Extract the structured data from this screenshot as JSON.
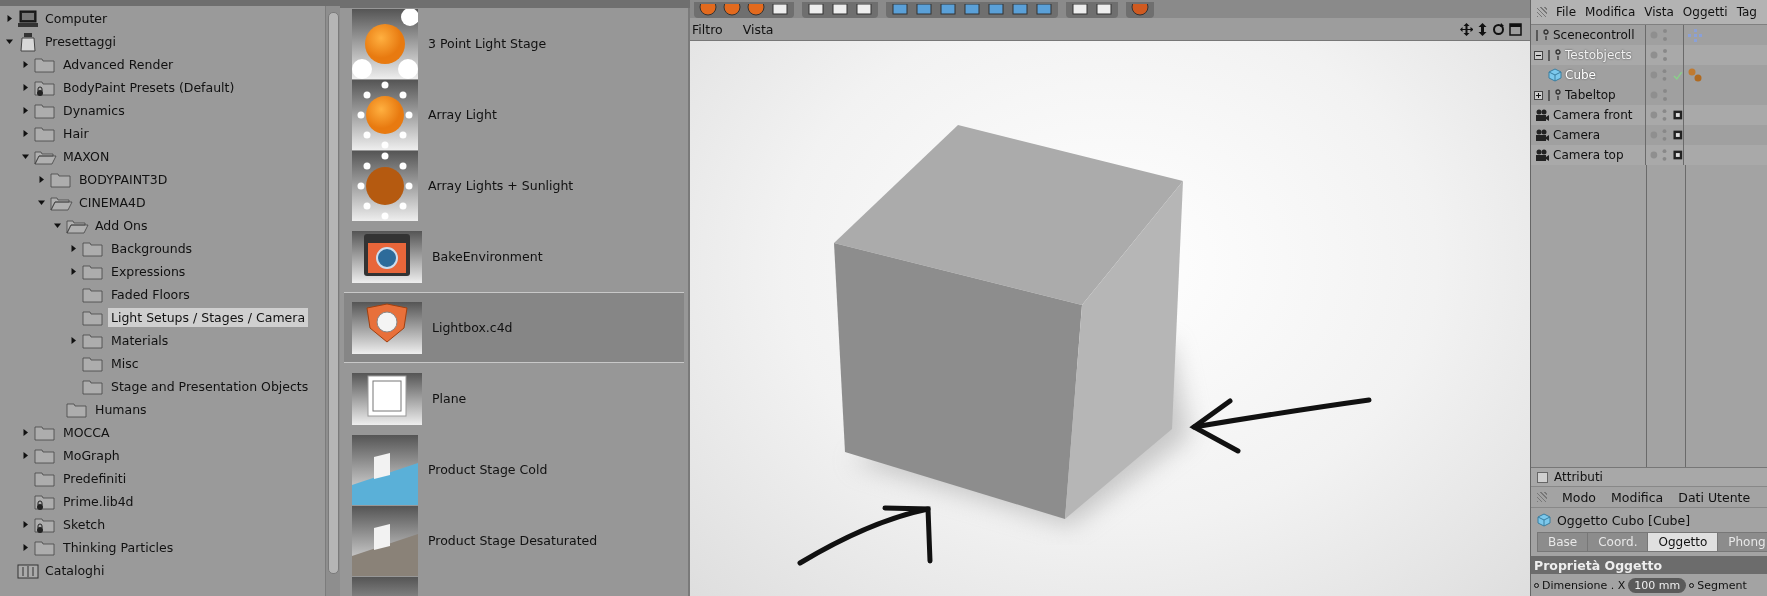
{
  "browser": {
    "tree": [
      {
        "label": "Computer",
        "kind": "computer",
        "expandable": true,
        "expanded": false,
        "selected": false
      },
      {
        "label": "Presettaggi",
        "kind": "library",
        "expandable": true,
        "expanded": true,
        "selected": false,
        "children": [
          {
            "label": "Advanced Render",
            "kind": "folder",
            "expandable": true,
            "expanded": false,
            "selected": false
          },
          {
            "label": "BodyPaint Presets (Default)",
            "kind": "locked-folder",
            "expandable": true,
            "expanded": false,
            "selected": false
          },
          {
            "label": "Dynamics",
            "kind": "folder",
            "expandable": true,
            "expanded": false,
            "selected": false
          },
          {
            "label": "Hair",
            "kind": "folder",
            "expandable": true,
            "expanded": false,
            "selected": false
          },
          {
            "label": "MAXON",
            "kind": "folder",
            "expandable": true,
            "expanded": true,
            "selected": false,
            "children": [
              {
                "label": "BODYPAINT3D",
                "kind": "folder",
                "expandable": true,
                "expanded": false,
                "selected": false
              },
              {
                "label": "CINEMA4D",
                "kind": "folder",
                "expandable": true,
                "expanded": true,
                "selected": false,
                "children": [
                  {
                    "label": "Add Ons",
                    "kind": "folder",
                    "expandable": true,
                    "expanded": true,
                    "selected": false,
                    "children": [
                      {
                        "label": "Backgrounds",
                        "kind": "folder",
                        "expandable": true,
                        "expanded": false,
                        "selected": false
                      },
                      {
                        "label": "Expressions",
                        "kind": "folder",
                        "expandable": true,
                        "expanded": false,
                        "selected": false
                      },
                      {
                        "label": "Faded Floors",
                        "kind": "folder",
                        "expandable": false,
                        "expanded": false,
                        "selected": false
                      },
                      {
                        "label": "Light Setups / Stages / Camera",
                        "kind": "folder",
                        "expandable": false,
                        "expanded": false,
                        "selected": true
                      },
                      {
                        "label": "Materials",
                        "kind": "folder",
                        "expandable": true,
                        "expanded": false,
                        "selected": false
                      },
                      {
                        "label": "Misc",
                        "kind": "folder",
                        "expandable": false,
                        "expanded": false,
                        "selected": false
                      },
                      {
                        "label": "Stage and Presentation Objects",
                        "kind": "folder",
                        "expandable": false,
                        "expanded": false,
                        "selected": false
                      }
                    ]
                  },
                  {
                    "label": "Humans",
                    "kind": "folder",
                    "expandable": false,
                    "expanded": false,
                    "selected": false
                  }
                ]
              }
            ]
          },
          {
            "label": "MOCCA",
            "kind": "folder",
            "expandable": true,
            "expanded": false,
            "selected": false
          },
          {
            "label": "MoGraph",
            "kind": "folder",
            "expandable": true,
            "expanded": false,
            "selected": false
          },
          {
            "label": "Predefiniti",
            "kind": "folder",
            "expandable": false,
            "expanded": false,
            "selected": false
          },
          {
            "label": "Prime.lib4d",
            "kind": "locked-folder",
            "expandable": false,
            "expanded": false,
            "selected": false
          },
          {
            "label": "Sketch",
            "kind": "locked-folder",
            "expandable": true,
            "expanded": false,
            "selected": false
          },
          {
            "label": "Thinking Particles",
            "kind": "folder",
            "expandable": true,
            "expanded": false,
            "selected": false
          }
        ]
      },
      {
        "label": "Cataloghi",
        "kind": "catalog",
        "expandable": false,
        "expanded": false,
        "selected": false
      }
    ]
  },
  "presets": [
    {
      "label": "3 Point Light Stage",
      "kind": "three-point",
      "selected": false
    },
    {
      "label": "Array Light",
      "kind": "array",
      "selected": false
    },
    {
      "label": "Array Lights + Sunlight",
      "kind": "array-sun",
      "selected": false
    },
    {
      "label": "BakeEnvironment",
      "kind": "bake",
      "selected": false
    },
    {
      "label": "Lightbox.c4d",
      "kind": "lightbox",
      "selected": true
    },
    {
      "label": "Plane",
      "kind": "plane",
      "selected": false
    },
    {
      "label": "Product Stage Cold",
      "kind": "stage-cold",
      "selected": false
    },
    {
      "label": "Product Stage Desaturated",
      "kind": "stage-desaturated",
      "selected": false
    },
    {
      "kind": "stage-partial",
      "selected": false
    }
  ],
  "viewport": {
    "menu": [
      "Filtro",
      "Vista"
    ]
  },
  "object_manager": {
    "menu": [
      "File",
      "Modifica",
      "Vista",
      "Oggetti",
      "Tag"
    ],
    "objects": [
      {
        "name": "Scenecontroll",
        "kind": "null",
        "selected": false,
        "dimmed": false,
        "expandable": false,
        "expanded": false,
        "tag": {
          "kind": "xpresso"
        },
        "tag_enabled": false
      },
      {
        "name": "Testobjects",
        "kind": "null",
        "selected": false,
        "dimmed": true,
        "expandable": true,
        "expanded": true,
        "tag_enabled": false,
        "children": [
          {
            "name": "Cube",
            "kind": "cube",
            "selected": true,
            "dimmed": false,
            "expandable": false,
            "expanded": false,
            "tag": {
              "kind": "material"
            },
            "tag_enabled": true
          }
        ]
      },
      {
        "name": "Tabeltop",
        "kind": "null",
        "selected": false,
        "dimmed": false,
        "expandable": true,
        "expanded": false,
        "tag_enabled": false
      },
      {
        "name": "Camera front",
        "kind": "camera",
        "selected": false,
        "dimmed": false,
        "expandable": false,
        "expanded": false,
        "tag": {
          "kind": "target"
        },
        "tag_enabled": false
      },
      {
        "name": "Camera",
        "kind": "camera",
        "selected": false,
        "dimmed": false,
        "expandable": false,
        "expanded": false,
        "tag": {
          "kind": "target"
        },
        "tag_enabled": false
      },
      {
        "name": "Camera top",
        "kind": "camera",
        "selected": false,
        "dimmed": false,
        "expandable": false,
        "expanded": false,
        "tag": {
          "kind": "target"
        },
        "tag_enabled": false
      }
    ]
  },
  "attributes": {
    "title": "Attributi",
    "checked": false,
    "menu": [
      "Modo",
      "Modifica",
      "Dati Utente"
    ],
    "object_title": "Oggetto Cubo [Cube]",
    "tabs": [
      {
        "label": "Base",
        "selected": false
      },
      {
        "label": "Coord.",
        "selected": false
      },
      {
        "label": "Oggetto",
        "selected": true
      },
      {
        "label": "Phong",
        "selected": false
      }
    ],
    "section": "Proprietà Oggetto",
    "fields": [
      {
        "label": "Dimensione . X",
        "value": "100 mm",
        "next_label": "Segment"
      }
    ]
  }
}
